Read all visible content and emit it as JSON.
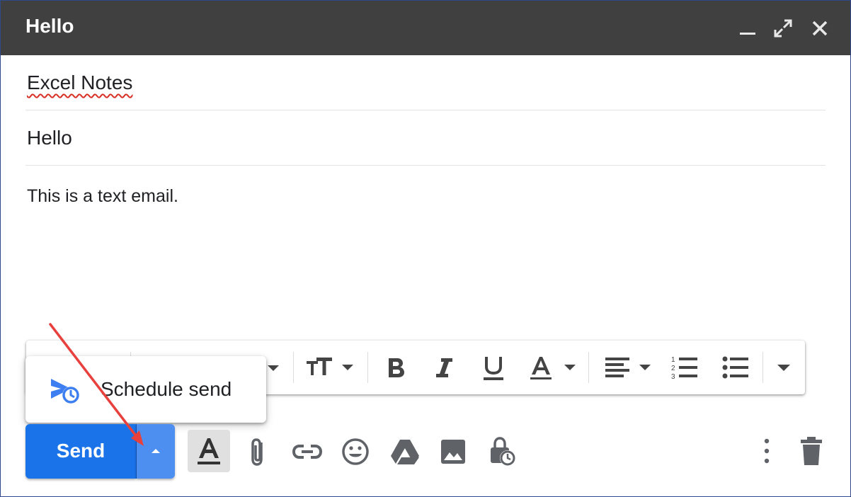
{
  "window": {
    "title": "Hello",
    "minimize_icon": "minimize-icon",
    "expand_icon": "expand-icon",
    "close_icon": "close-icon"
  },
  "fields": {
    "recipient": "Excel Notes",
    "subject": "Hello"
  },
  "body": {
    "text": "This is a text email."
  },
  "schedule_menu": {
    "item_label": "Schedule send",
    "icon": "schedule-send-icon"
  },
  "send": {
    "label": "Send",
    "more_icon": "caret-up-icon"
  },
  "formatting_toolbar": {
    "items": [
      "font-size-icon",
      "bold-icon",
      "italic-icon",
      "underline-icon",
      "text-color-icon",
      "align-icon",
      "numbered-list-icon",
      "bulleted-list-icon",
      "more-formatting-icon"
    ]
  },
  "bottom_toolbar": {
    "items": [
      "formatting-options-icon",
      "attach-icon",
      "link-icon",
      "emoji-icon",
      "drive-icon",
      "photo-icon",
      "confidential-mode-icon",
      "more-options-icon",
      "trash-icon"
    ]
  },
  "colors": {
    "titlebar": "#404040",
    "send_primary": "#1a73e8",
    "send_secondary": "#4d8ff0",
    "annotation_arrow": "#e8413d"
  }
}
